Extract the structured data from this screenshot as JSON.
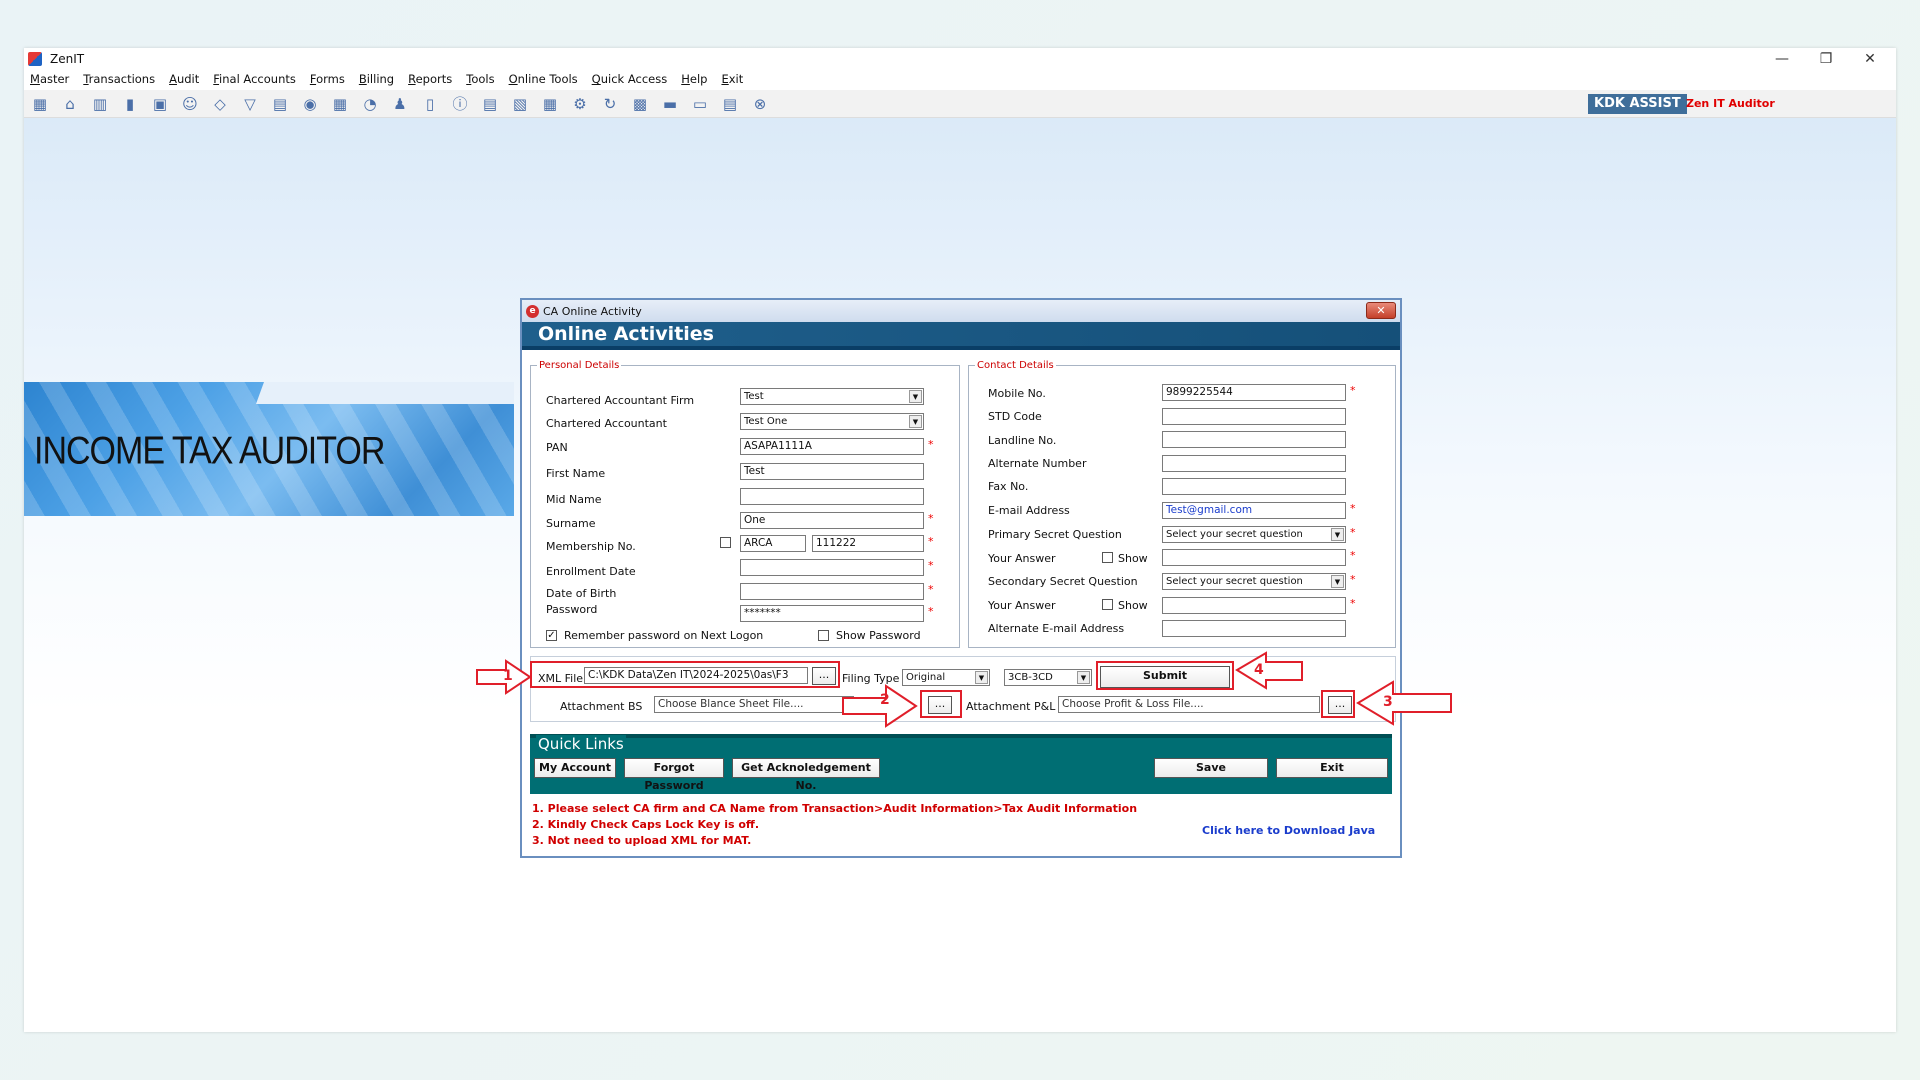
{
  "app": {
    "title": "ZenIT"
  },
  "window_controls": {
    "minimize": "—",
    "restore": "❐",
    "close": "✕"
  },
  "menu": [
    "Master",
    "Transactions",
    "Audit",
    "Final Accounts",
    "Forms",
    "Billing",
    "Reports",
    "Tools",
    "Online Tools",
    "Quick Access",
    "Help",
    "Exit"
  ],
  "toolbar_icons": [
    "dashboard-icon",
    "home-icon",
    "building-icon",
    "bar-chart-icon",
    "gift-icon",
    "users-icon",
    "tag-icon",
    "filter-icon",
    "tax-icon",
    "disc-icon",
    "calculator-icon",
    "pie-icon",
    "pay-icon",
    "book-icon",
    "info-icon",
    "report-icon",
    "document-edit-icon",
    "calendar-icon",
    "gear-icon",
    "refresh-icon",
    "bs-icon",
    "truck-icon",
    "3cd-icon",
    "ledger-icon",
    "close-circle-icon"
  ],
  "brand": {
    "kdk": "KDK ASSIST",
    "zen": "Zen IT Auditor"
  },
  "banner": {
    "text": "INCOME TAX AUDITOR"
  },
  "dialog": {
    "title": "CA Online Activity",
    "close": "✕",
    "heading": "Online Activities",
    "personal": {
      "legend": "Personal Details",
      "ca_firm_label": "Chartered Accountant Firm",
      "ca_firm_value": "Test",
      "ca_label": "Chartered Accountant",
      "ca_value": "Test One",
      "pan_label": "PAN",
      "pan_value": "ASAPA1111A",
      "first_name_label": "First Name",
      "first_name_value": "Test",
      "mid_name_label": "Mid Name",
      "mid_name_value": "",
      "surname_label": "Surname",
      "surname_value": "One",
      "membership_label": "Membership No.",
      "membership_prefix": "ARCA",
      "membership_value": "111222",
      "enrollment_label": "Enrollment Date",
      "enrollment_value": "",
      "dob_label": "Date of Birth",
      "dob_value": "",
      "password_label": "Password",
      "password_value": "*******",
      "remember_label": "Remember password on Next Logon",
      "show_password_label": "Show Password"
    },
    "contact": {
      "legend": "Contact Details",
      "mobile_label": "Mobile No.",
      "mobile_value": "9899225544",
      "std_label": "STD Code",
      "std_value": "",
      "landline_label": "Landline No.",
      "landline_value": "",
      "alternate_label": "Alternate Number",
      "alternate_value": "",
      "fax_label": "Fax No.",
      "fax_value": "",
      "email_label": "E-mail Address",
      "email_value": "Test@gmail.com",
      "primary_q_label": "Primary Secret Question",
      "primary_q_value": "Select your secret question",
      "answer_label": "Your Answer",
      "show_label": "Show",
      "secondary_q_label": "Secondary Secret Question",
      "secondary_q_value": "Select your secret question",
      "alt_email_label": "Alternate E-mail Address",
      "alt_email_value": ""
    },
    "xml": {
      "label": "XML File",
      "value": "C:\\KDK Data\\Zen IT\\2024-2025\\0as\\F3",
      "browse": "...",
      "filing_type_label": "Filing Type",
      "filing_type_value": "Original",
      "form_value": "3CB-3CD",
      "submit": "Submit",
      "attach_bs_label": "Attachment BS",
      "attach_bs_placeholder": "Choose Blance Sheet File....",
      "attach_pl_label": "Attachment P&L",
      "attach_pl_placeholder": "Choose Profit & Loss File...."
    },
    "quick_links": {
      "title": "Quick Links",
      "my_account": "My Account",
      "forgot_password": "Forgot Password",
      "ack_no": "Get Acknoledgement No.",
      "save": "Save",
      "exit": "Exit"
    },
    "notes": [
      "1. Please select CA firm and CA Name from Transaction>Audit Information>Tax Audit Information",
      "2. Kindly Check Caps Lock Key is off.",
      "3. Not need to upload XML for MAT."
    ],
    "java_link": "Click here to Download Java"
  },
  "annotations": [
    "1",
    "2",
    "3",
    "4"
  ],
  "colors": {
    "annotation": "#e01f2a",
    "header": "#1f5f8c",
    "quick_links": "#006e73",
    "kdk": "#3f6e9a"
  }
}
